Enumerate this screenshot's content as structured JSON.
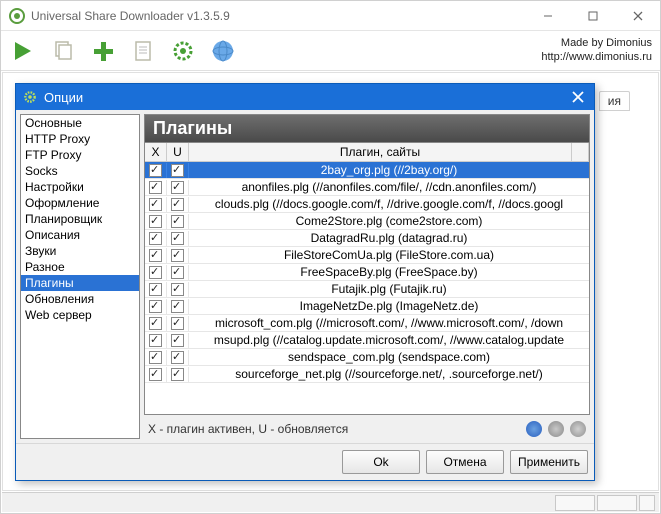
{
  "window": {
    "title": "Universal Share Downloader v1.3.5.9",
    "credits_line1": "Made by Dimonius",
    "credits_line2": "http://www.dimonius.ru"
  },
  "bg_tab": "ия",
  "dialog": {
    "title": "Опции",
    "categories": [
      "Основные",
      "HTTP Proxy",
      "FTP Proxy",
      "Socks",
      "Настройки",
      "Оформление",
      "Планировщик",
      "Описания",
      "Звуки",
      "Разное",
      "Плагины",
      "Обновления",
      "Web сервер"
    ],
    "selected_category_index": 10,
    "pane_title": "Плагины",
    "table": {
      "col_x": "X",
      "col_u": "U",
      "col_name": "Плагин, сайты",
      "rows": [
        {
          "x": true,
          "u": true,
          "name": "2bay_org.plg (//2bay.org/)",
          "selected": true
        },
        {
          "x": true,
          "u": true,
          "name": "anonfiles.plg (//anonfiles.com/file/, //cdn.anonfiles.com/)"
        },
        {
          "x": true,
          "u": true,
          "name": "clouds.plg (//docs.google.com/f, //drive.google.com/f, //docs.googl"
        },
        {
          "x": true,
          "u": true,
          "name": "Come2Store.plg (come2store.com)"
        },
        {
          "x": true,
          "u": true,
          "name": "DatagradRu.plg (datagrad.ru)"
        },
        {
          "x": true,
          "u": true,
          "name": "FileStoreComUa.plg (FileStore.com.ua)"
        },
        {
          "x": true,
          "u": true,
          "name": "FreeSpaceBy.plg (FreeSpace.by)"
        },
        {
          "x": true,
          "u": true,
          "name": "Futajik.plg (Futajik.ru)"
        },
        {
          "x": true,
          "u": true,
          "name": "ImageNetzDe.plg (ImageNetz.de)"
        },
        {
          "x": true,
          "u": true,
          "name": "microsoft_com.plg (//microsoft.com/, //www.microsoft.com/, /down"
        },
        {
          "x": true,
          "u": true,
          "name": "msupd.plg (//catalog.update.microsoft.com/, //www.catalog.update"
        },
        {
          "x": true,
          "u": true,
          "name": "sendspace_com.plg (sendspace.com)"
        },
        {
          "x": true,
          "u": true,
          "name": "sourceforge_net.plg (//sourceforge.net/, .sourceforge.net/)"
        }
      ]
    },
    "legend": "X - плагин активен, U - обновляется",
    "buttons": {
      "ok": "Ok",
      "cancel": "Отмена",
      "apply": "Применить"
    }
  }
}
